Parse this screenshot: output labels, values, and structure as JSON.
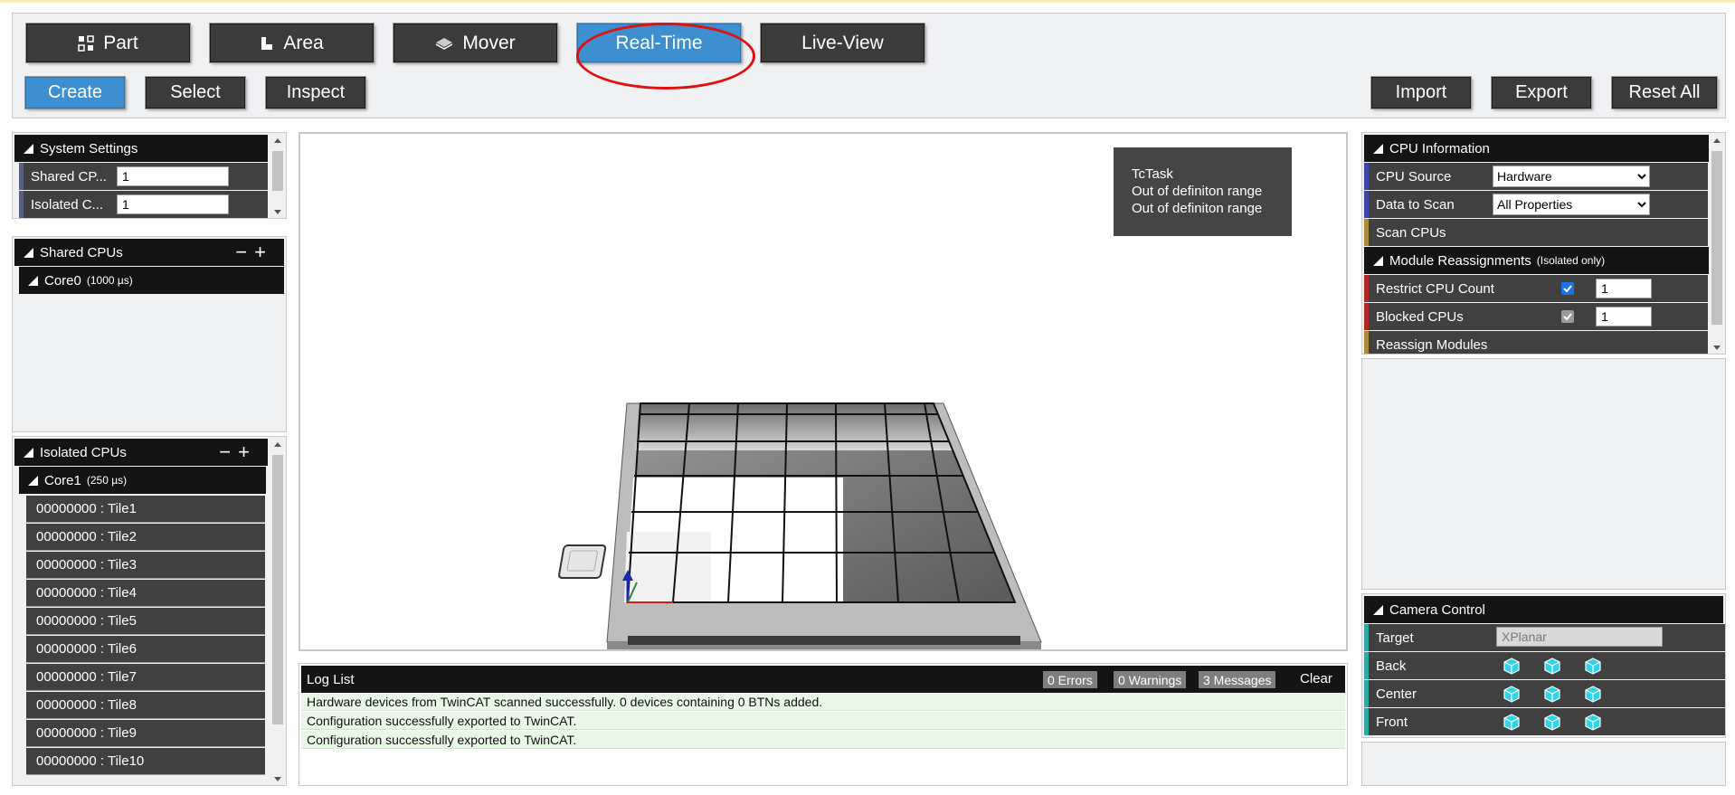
{
  "modes": {
    "part": "Part",
    "area": "Area",
    "mover": "Mover",
    "realtime": "Real-Time",
    "liveview": "Live-View"
  },
  "actions": {
    "create": "Create",
    "select": "Select",
    "inspect": "Inspect",
    "import": "Import",
    "export": "Export",
    "reset_all": "Reset All"
  },
  "system_settings": {
    "title": "System Settings",
    "shared_label": "Shared CP...",
    "shared_value": "1",
    "isolated_label": "Isolated C...",
    "isolated_value": "1"
  },
  "shared_cpus": {
    "title": "Shared CPUs",
    "core_name": "Core0",
    "core_cycle": "(1000 µs)"
  },
  "isolated_cpus": {
    "title": "Isolated CPUs",
    "core_name": "Core1",
    "core_cycle": "(250 µs)",
    "tiles": [
      "00000000 : Tile1",
      "00000000 : Tile2",
      "00000000 : Tile3",
      "00000000 : Tile4",
      "00000000 : Tile5",
      "00000000 : Tile6",
      "00000000 : Tile7",
      "00000000 : Tile8",
      "00000000 : Tile9",
      "00000000 : Tile10"
    ]
  },
  "info_box": {
    "line1": "TcTask",
    "line2": "Out of definiton range",
    "line3": "Out of definiton range"
  },
  "log": {
    "title": "Log List",
    "errors": "0 Errors",
    "warnings": "0 Warnings",
    "messages": "3 Messages",
    "clear": "Clear",
    "entries": [
      "Hardware devices from TwinCAT scanned successfully. 0 devices containing 0 BTNs added.",
      "Configuration successfully exported to TwinCAT.",
      "Configuration successfully exported to TwinCAT."
    ]
  },
  "cpu_info": {
    "title": "CPU Information",
    "cpu_source_label": "CPU Source",
    "cpu_source_value": "Hardware",
    "data_to_scan_label": "Data to Scan",
    "data_to_scan_value": "All Properties",
    "scan_cpus": "Scan CPUs"
  },
  "module_reassign": {
    "title": "Module Reassignments",
    "subtitle": "(Isolated only)",
    "restrict_label": "Restrict CPU Count",
    "restrict_value": "1",
    "blocked_label": "Blocked CPUs",
    "blocked_value": "1",
    "reassign": "Reassign Modules"
  },
  "camera": {
    "title": "Camera Control",
    "target_label": "Target",
    "target_value": "XPlanar",
    "back": "Back",
    "center": "Center",
    "front": "Front"
  },
  "colors": {
    "accent": "#3d8fd0",
    "highlight": "#e01010",
    "icon_cyan": "#2fd4e8"
  }
}
